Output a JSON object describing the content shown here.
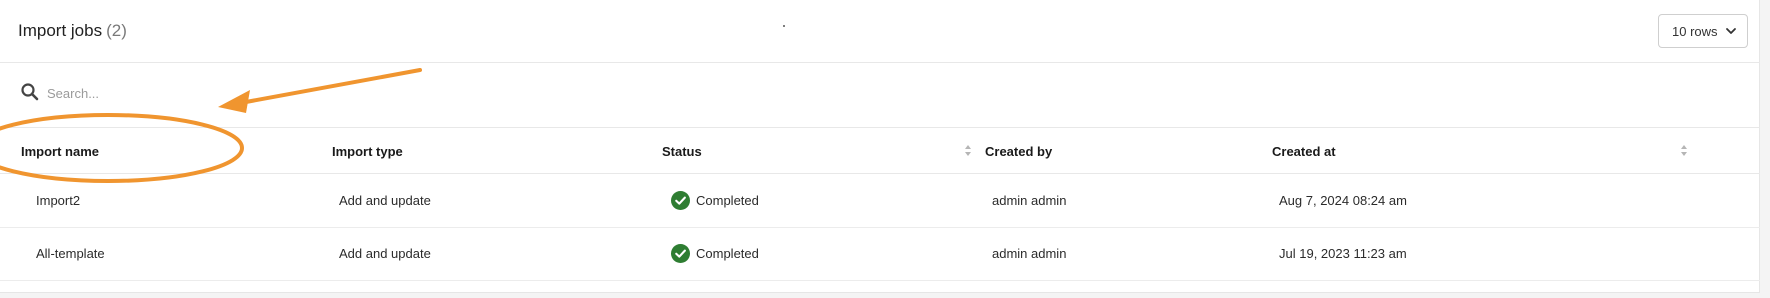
{
  "header": {
    "title": "Import jobs",
    "count": "(2)",
    "rows_select": "10 rows"
  },
  "search": {
    "placeholder": "Search..."
  },
  "table": {
    "columns": [
      {
        "label": "Import name"
      },
      {
        "label": "Import type"
      },
      {
        "label": "Status"
      },
      {
        "label": "Created by"
      },
      {
        "label": "Created at"
      }
    ],
    "rows": [
      {
        "name": "Import2",
        "type": "Add and update",
        "status": "Completed",
        "created_by": "admin admin",
        "created_at": "Aug 7, 2024 08:24 am"
      },
      {
        "name": "All-template",
        "type": "Add and update",
        "status": "Completed",
        "created_by": "admin admin",
        "created_at": "Jul 19, 2023 11:23 am"
      }
    ]
  },
  "colors": {
    "status_completed": "#2e7d32",
    "annotation": "#f0952f"
  },
  "icons": {
    "search": "search-icon",
    "sort": "sort-icon",
    "status": "check-circle-icon",
    "select": "chevron-down-icon"
  }
}
